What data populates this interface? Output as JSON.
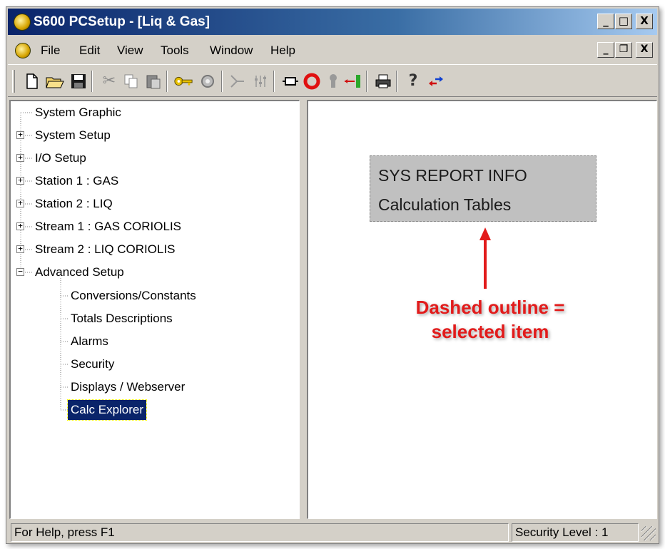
{
  "window": {
    "title": "S600 PCSetup - [Liq & Gas]",
    "controls": {
      "minimize": "_",
      "maximize": "□",
      "close": "X"
    }
  },
  "menu": {
    "items": [
      "File",
      "Edit",
      "View",
      "Tools",
      "Window",
      "Help"
    ],
    "mdi_controls": {
      "minimize": "_",
      "restore": "❐",
      "close": "X"
    }
  },
  "toolbar": {
    "icons": [
      "new-document-icon",
      "open-folder-icon",
      "save-icon",
      "cut-icon",
      "copy-icon",
      "paste-icon",
      "key-icon",
      "security-icon",
      "connect-icon",
      "settings-icon",
      "stop-icon",
      "ring-icon",
      "pin-icon",
      "transfer-icon",
      "print-icon",
      "help-icon",
      "swap-icon"
    ]
  },
  "tree": {
    "items": [
      {
        "label": "System Graphic",
        "level": 0,
        "expander": ""
      },
      {
        "label": "System Setup",
        "level": 0,
        "expander": "+"
      },
      {
        "label": "I/O Setup",
        "level": 0,
        "expander": "+"
      },
      {
        "label": "Station 1 : GAS",
        "level": 0,
        "expander": "+"
      },
      {
        "label": "Station 2 : LIQ",
        "level": 0,
        "expander": "+"
      },
      {
        "label": "Stream 1 : GAS CORIOLIS",
        "level": 0,
        "expander": "+"
      },
      {
        "label": "Stream 2 : LIQ CORIOLIS",
        "level": 0,
        "expander": "+"
      },
      {
        "label": "Advanced Setup",
        "level": 0,
        "expander": "−"
      },
      {
        "label": "Conversions/Constants",
        "level": 1,
        "expander": ""
      },
      {
        "label": "Totals Descriptions",
        "level": 1,
        "expander": ""
      },
      {
        "label": "Alarms",
        "level": 1,
        "expander": ""
      },
      {
        "label": "Security",
        "level": 1,
        "expander": ""
      },
      {
        "label": "Displays / Webserver",
        "level": 1,
        "expander": ""
      },
      {
        "label": "Calc Explorer",
        "level": 1,
        "expander": "",
        "selected": true
      }
    ]
  },
  "main": {
    "sys_box": {
      "line1": "SYS REPORT INFO",
      "line2": "Calculation Tables"
    },
    "annotation": {
      "line1": "Dashed outline =",
      "line2": "selected item"
    }
  },
  "status": {
    "help_text": "For Help, press F1",
    "security_level": "Security Level : 1"
  },
  "colors": {
    "title_gradient_start": "#0a246a",
    "selection_bg": "#0a246a",
    "annotation_red": "#e21b1b",
    "chrome": "#d4d0c8"
  }
}
